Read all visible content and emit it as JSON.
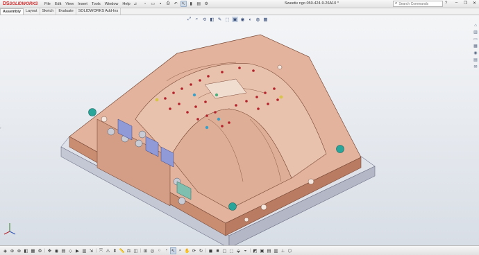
{
  "app": {
    "logo_ds": "DS",
    "logo_name": "SOLIDWORKS",
    "document_title": "Sweetiv ngo 050-424-9-26A10 *",
    "menu": [
      "File",
      "Edit",
      "View",
      "Insert",
      "Tools",
      "Window",
      "Help"
    ]
  },
  "quick_access": {
    "icons": [
      "new-icon",
      "open-icon",
      "save-icon",
      "print-icon",
      "undo-icon",
      "redo-icon",
      "select-icon",
      "rebuild-icon",
      "options-icon"
    ]
  },
  "search": {
    "placeholder": "Search Commands"
  },
  "window_controls": [
    "minimize-icon",
    "restore-icon",
    "close-icon"
  ],
  "tabs": [
    "Assembly",
    "Layout",
    "Sketch",
    "Evaluate",
    "SOLIDWORKS Add-Ins"
  ],
  "active_tab": "Assembly",
  "colors": {
    "accent": "#d12a2a",
    "mold_copper": "#d9a48c",
    "base_plate": "#c9ccd8",
    "teal_marker": "#2aa59a",
    "red_hole": "#b3212a"
  }
}
